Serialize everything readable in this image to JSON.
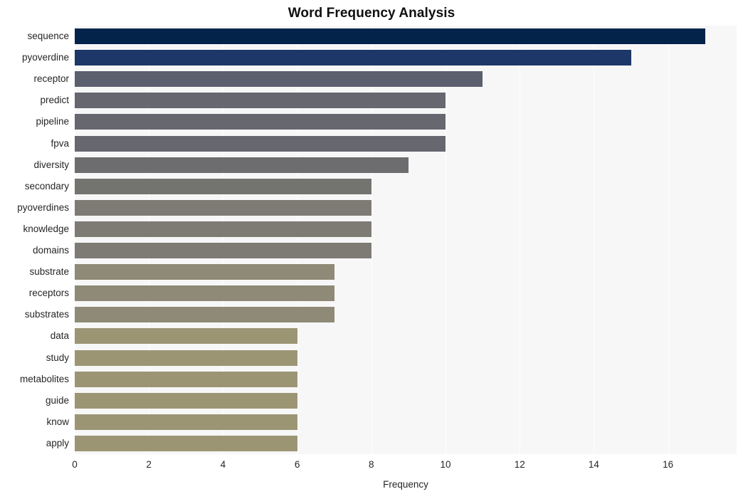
{
  "chart_data": {
    "type": "bar",
    "orientation": "horizontal",
    "title": "Word Frequency Analysis",
    "xlabel": "Frequency",
    "ylabel": "",
    "xlim": [
      0,
      17.85
    ],
    "xticks": [
      0,
      2,
      4,
      6,
      8,
      10,
      12,
      14,
      16
    ],
    "xtick_labels": [
      "0",
      "2",
      "4",
      "6",
      "8",
      "10",
      "12",
      "14",
      "16"
    ],
    "grid": "vertical-only",
    "legend": "none",
    "categories": [
      "sequence",
      "pyoverdine",
      "receptor",
      "predict",
      "pipeline",
      "fpva",
      "diversity",
      "secondary",
      "pyoverdines",
      "knowledge",
      "domains",
      "substrate",
      "receptors",
      "substrates",
      "data",
      "study",
      "metabolites",
      "guide",
      "know",
      "apply"
    ],
    "values": [
      17,
      15,
      11,
      10,
      10,
      10,
      9,
      8,
      8,
      8,
      8,
      7,
      7,
      7,
      6,
      6,
      6,
      6,
      6,
      6
    ],
    "bar_colors": [
      "#04234b",
      "#1c3768",
      "#5b5f6e",
      "#66676f",
      "#66676f",
      "#66676f",
      "#6d6d6f",
      "#737370",
      "#7d7b74",
      "#7d7b74",
      "#7d7b74",
      "#8e8a77",
      "#8e8a77",
      "#8e8a77",
      "#9c9574",
      "#9c9574",
      "#9c9574",
      "#9c9574",
      "#9c9574",
      "#9c9574"
    ],
    "plot_background": "#f7f7f7",
    "gridline_color": "#ffffff",
    "text_color": "#262626"
  }
}
